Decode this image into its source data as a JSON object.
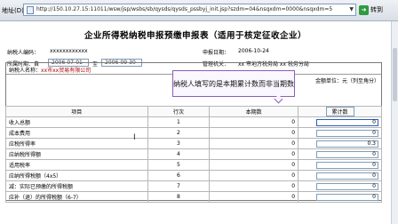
{
  "browser": {
    "address_label": "地址(D)",
    "url": "http://150.10.27.15:11011/wsw/jsp/wsbs/sb/qysds/qysds_pssbyj_init.jsp?szdm=04&nsqxdm=0000&nsqxdm=5",
    "go_label": "转到"
  },
  "form": {
    "title": "企业所得税纳税申报预缴申报表（适用于核定征收企业）",
    "taxpayer_id_label": "纳税人编码：",
    "taxpayer_id_value": "xxxxxxxxxxxx",
    "period_label": "所属时期：自",
    "period_from": "2006-07-01",
    "period_to_label": "至",
    "period_to": "2006-09-30",
    "declare_date_label": "申报日期：",
    "declare_date_value": "2006-10-24",
    "authority_label": "管理机关：",
    "authority_value": "xx 市地方税务局 xx 税务分局",
    "unit_note": "金额单位：元（列至角分）",
    "payer_name_label": "纳税人名称：",
    "payer_name_value": "xx市xx贸易有限公司"
  },
  "callout": {
    "text": "纳税人填写的是本期累计数而非当期数"
  },
  "table": {
    "headers": [
      "项目",
      "行次",
      "本期数",
      "累计数"
    ],
    "rows": [
      {
        "item": "收入总额",
        "line": "1",
        "current": "0",
        "cumulative": "0"
      },
      {
        "item": "成本费用",
        "line": "2",
        "current": "0",
        "cumulative": "0"
      },
      {
        "item": "应税所得率",
        "line": "3",
        "current": "0",
        "cumulative": "0.3"
      },
      {
        "item": "应纳税所得额",
        "line": "4",
        "current": "0",
        "cumulative": "0"
      },
      {
        "item": "适用税率",
        "line": "5",
        "current": "0",
        "cumulative": "0"
      },
      {
        "item": "应纳所得税额（4x5）",
        "line": "6",
        "current": "0",
        "cumulative": "0"
      },
      {
        "item": "减：实际已预缴的所得税额",
        "line": "7",
        "current": "0",
        "cumulative": "0"
      },
      {
        "item": "应补（退）的所得税额（6-7）",
        "line": "8",
        "current": "0",
        "cumulative": "0"
      }
    ]
  },
  "colors": {
    "callout_border": "#8b5fb6",
    "payer_name": "#b00000"
  }
}
